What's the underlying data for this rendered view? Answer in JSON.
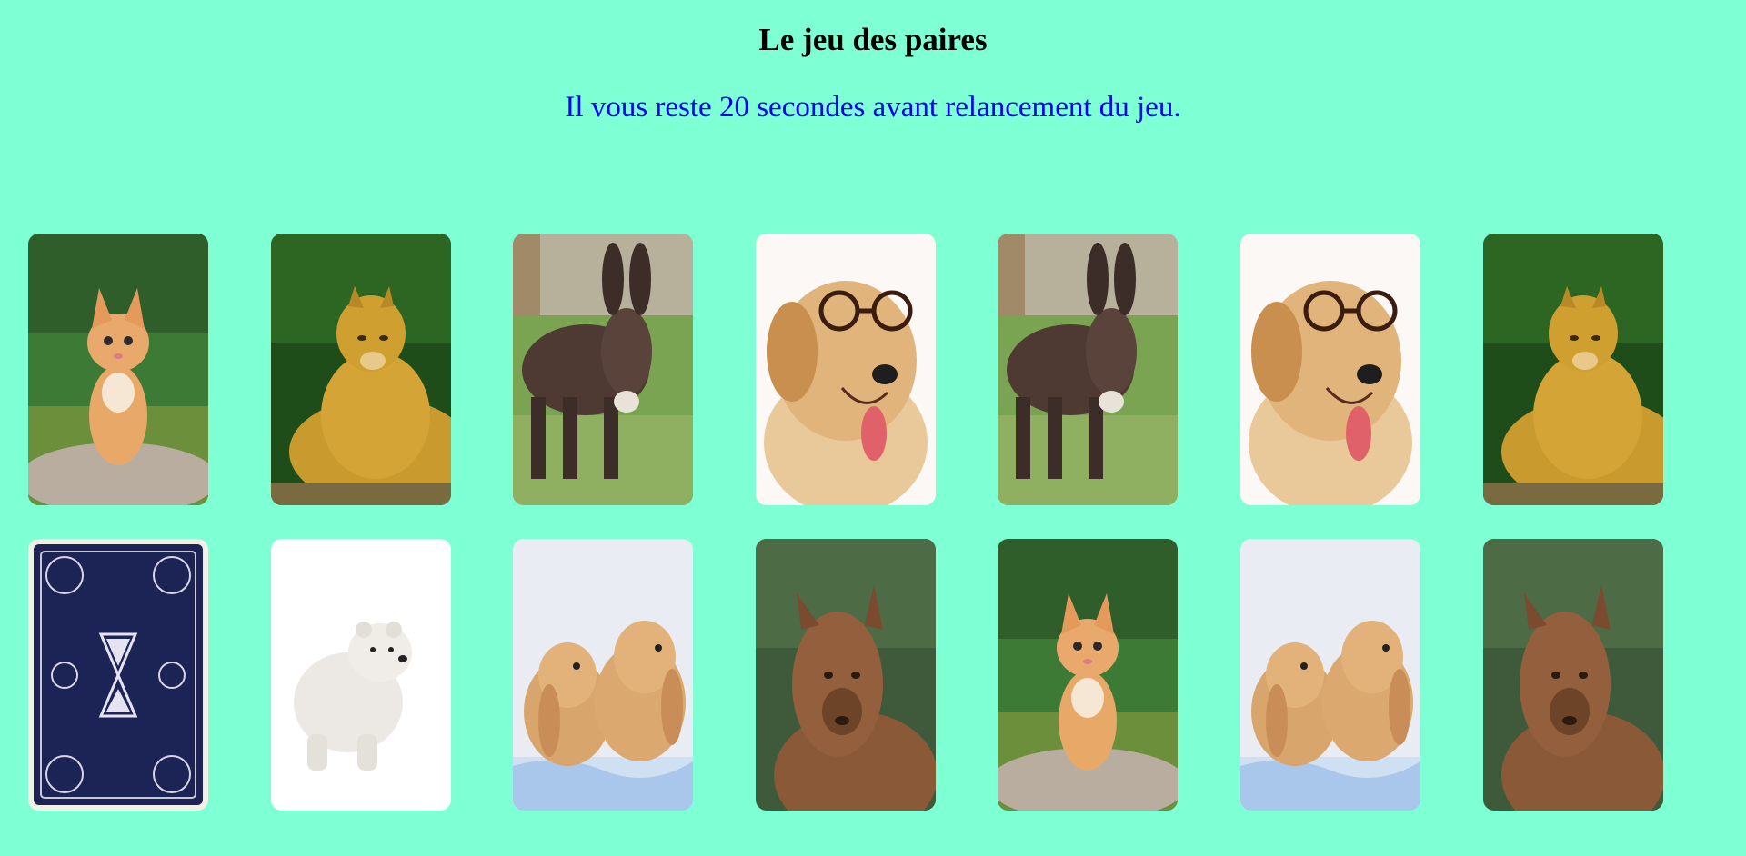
{
  "game": {
    "title": "Le jeu des paires",
    "timer_text": "Il vous reste 20 secondes avant relancement du jeu."
  },
  "cards": [
    {
      "animal": "kitten",
      "state": "face-up"
    },
    {
      "animal": "lioness",
      "state": "face-up"
    },
    {
      "animal": "donkey",
      "state": "face-up"
    },
    {
      "animal": "dog-with-glasses",
      "state": "face-up"
    },
    {
      "animal": "donkey",
      "state": "face-up"
    },
    {
      "animal": "dog-with-glasses",
      "state": "face-up"
    },
    {
      "animal": "lioness",
      "state": "face-up"
    },
    {
      "animal": "card-back",
      "state": "face-down"
    },
    {
      "animal": "polar-bear-cub",
      "state": "face-up"
    },
    {
      "animal": "bunnies",
      "state": "face-up"
    },
    {
      "animal": "alpaca",
      "state": "face-up"
    },
    {
      "animal": "kitten",
      "state": "face-up"
    },
    {
      "animal": "bunnies",
      "state": "face-up"
    },
    {
      "animal": "alpaca",
      "state": "face-up"
    }
  ],
  "colors": {
    "background": "#7FFFD4",
    "timer": "#0000FF",
    "card_back": "#1c2456"
  }
}
